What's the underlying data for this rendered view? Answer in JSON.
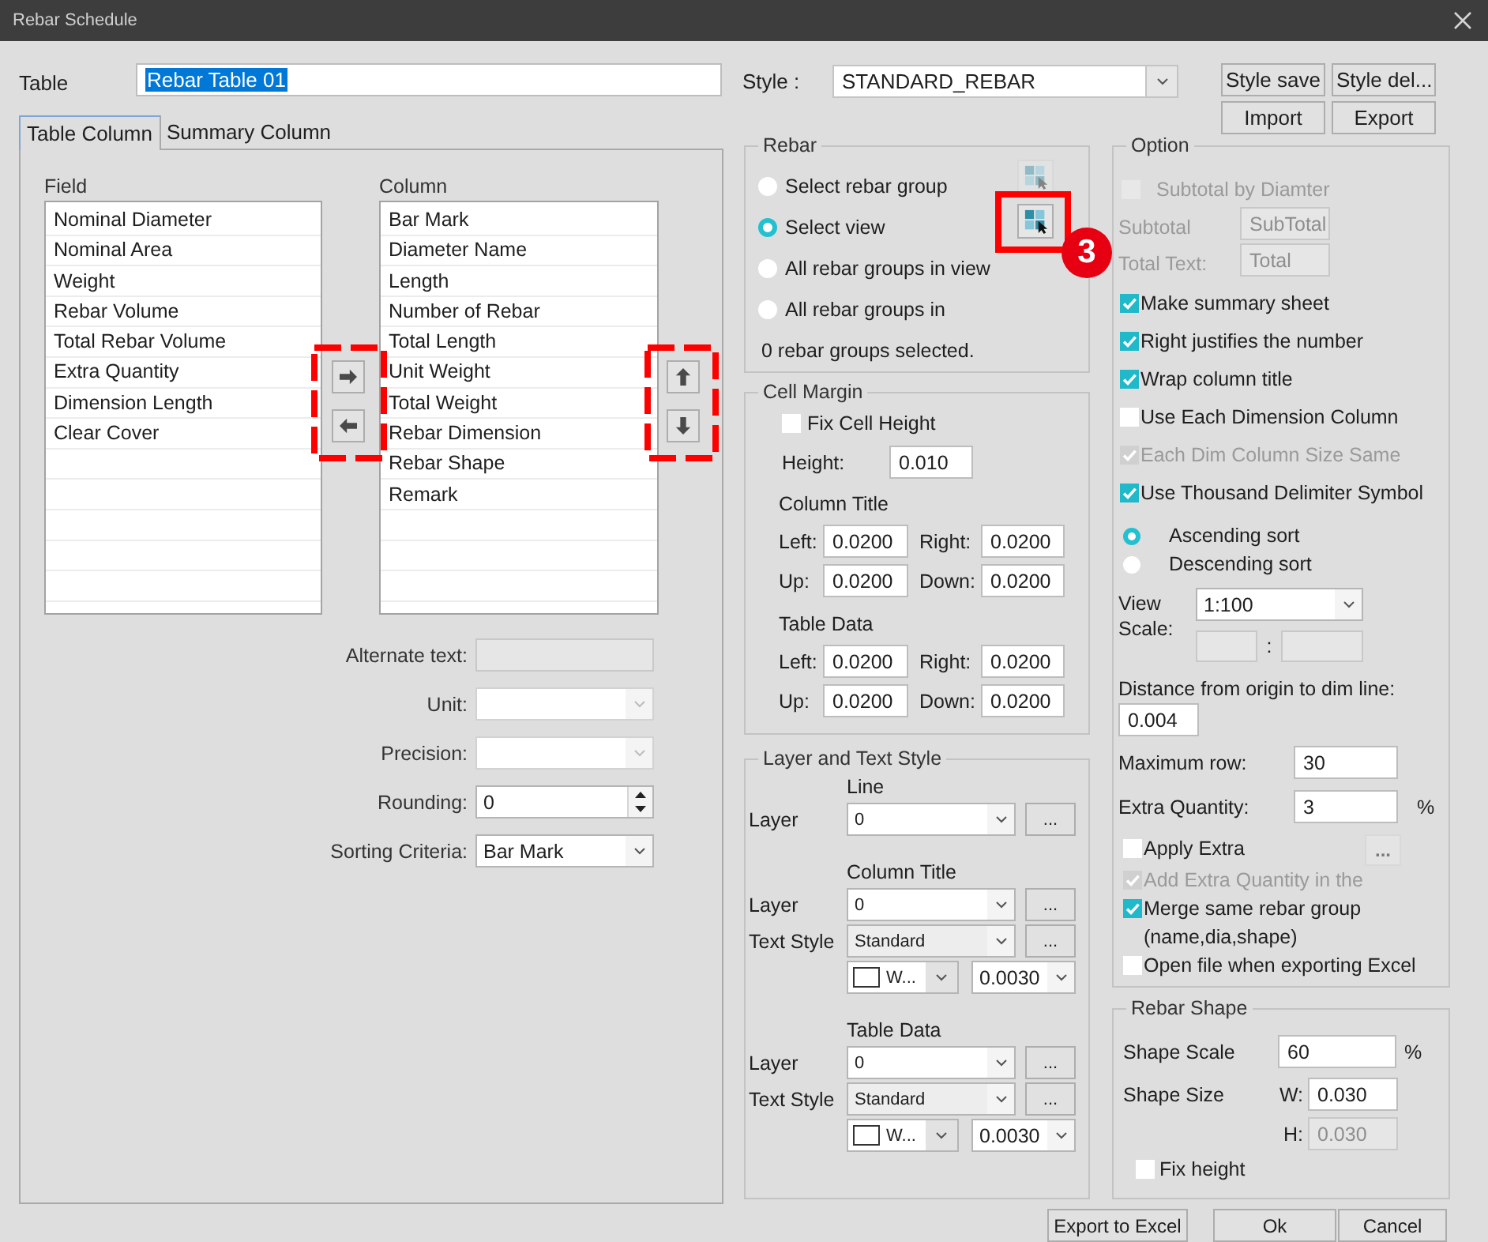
{
  "window": {
    "title": "Rebar Schedule"
  },
  "table": {
    "label": "Table",
    "value": "Rebar Table 01",
    "text_selected": true
  },
  "style": {
    "label": "Style :",
    "value": "STANDARD_REBAR"
  },
  "style_buttons": [
    "Style save",
    "Style del...",
    "Import",
    "Export"
  ],
  "tabs": [
    {
      "label": "Table Column",
      "selected": true
    },
    {
      "label": "Summary Column",
      "selected": false
    }
  ],
  "field_list": {
    "title": "Field",
    "items": [
      "Nominal Diameter",
      "Nominal Area",
      "Weight",
      "Rebar Volume",
      "Total Rebar Volume",
      "Extra Quantity",
      "Dimension Length",
      "Clear Cover"
    ]
  },
  "transfer_buttons": {
    "highlighted": true
  },
  "column_list": {
    "title": "Column",
    "items": [
      "Bar Mark",
      "Diameter Name",
      "Length",
      "Number of Rebar",
      "Total Length",
      "Unit Weight",
      "Total Weight",
      "Rebar Dimension",
      "Rebar Shape",
      "Remark"
    ]
  },
  "order_buttons": {
    "highlighted": true
  },
  "column_settings": [
    {
      "kind": "text",
      "label": "Alternate text:",
      "disabled": true
    },
    {
      "kind": "combo",
      "label": "Unit:",
      "disabled": true
    },
    {
      "kind": "combo",
      "label": "Precision:",
      "disabled": true
    },
    {
      "kind": "spin",
      "label": "Rounding:",
      "value": "0",
      "disabled": false
    },
    {
      "kind": "combo",
      "label": "Sorting Criteria:",
      "value": "Bar Mark",
      "disabled": false
    }
  ],
  "rebar": {
    "title": "Rebar",
    "options": [
      {
        "label": "Select rebar group",
        "selected": false
      },
      {
        "label": "Select view",
        "selected": true
      },
      {
        "label": "All rebar groups in view",
        "selected": false
      },
      {
        "label": "All rebar groups in",
        "selected": false
      }
    ],
    "pick_buttons": [
      {
        "disabled": true,
        "highlighted": false
      },
      {
        "disabled": false,
        "highlighted": true,
        "badge": "3"
      }
    ],
    "status": "0 rebar groups selected."
  },
  "cell_margin": {
    "title": "Cell Margin",
    "fix_cell_height": {
      "label": "Fix Cell Height",
      "checked": false
    },
    "height": {
      "label": "Height:",
      "value": "0.010"
    },
    "sections": [
      {
        "title": "Column Title",
        "fields": [
          {
            "label": "Left:",
            "value": "0.0200"
          },
          {
            "label": "Right:",
            "value": "0.0200"
          },
          {
            "label": "Up:",
            "value": "0.0200"
          },
          {
            "label": "Down:",
            "value": "0.0200"
          }
        ]
      },
      {
        "title": "Table Data",
        "fields": [
          {
            "label": "Left:",
            "value": "0.0200"
          },
          {
            "label": "Right:",
            "value": "0.0200"
          },
          {
            "label": "Up:",
            "value": "0.0200"
          },
          {
            "label": "Down:",
            "value": "0.0200"
          }
        ]
      }
    ]
  },
  "layer_text_style": {
    "title": "Layer and Text Style",
    "sections": [
      {
        "title": "Line",
        "rows": [
          {
            "kind": "layer",
            "label": "Layer",
            "value": "0",
            "more": "..."
          }
        ]
      },
      {
        "title": "Column Title",
        "rows": [
          {
            "kind": "layer",
            "label": "Layer",
            "value": "0",
            "more": "..."
          },
          {
            "kind": "text_style",
            "label": "Text Style",
            "value": "Standard",
            "more": "..."
          },
          {
            "kind": "color_size",
            "color": "#ffffff",
            "color_label": "W...",
            "size": "0.0030"
          }
        ]
      },
      {
        "title": "Table Data",
        "rows": [
          {
            "kind": "layer",
            "label": "Layer",
            "value": "0",
            "more": "..."
          },
          {
            "kind": "text_style",
            "label": "Text Style",
            "value": "Standard",
            "more": "..."
          },
          {
            "kind": "color_size",
            "color": "#ffffff",
            "color_label": "W...",
            "size": "0.0030"
          }
        ]
      }
    ]
  },
  "option": {
    "title": "Option",
    "subtotal_by_diameter": {
      "label": "Subtotal by Diamter",
      "checked": false,
      "disabled": true
    },
    "subtotal_fields": [
      {
        "label": "Subtotal",
        "value": "SubTotal",
        "disabled": true
      },
      {
        "label": "Total Text:",
        "value": "Total",
        "disabled": true
      }
    ],
    "checks": [
      {
        "label": "Make summary sheet",
        "checked": true,
        "disabled": false
      },
      {
        "label": "Right justifies the number",
        "checked": true,
        "disabled": false
      },
      {
        "label": "Wrap column title",
        "checked": true,
        "disabled": false
      },
      {
        "label": "Use Each Dimension Column",
        "checked": false,
        "disabled": false
      },
      {
        "label": "Each Dim Column Size Same",
        "checked": true,
        "disabled": true
      },
      {
        "label": "Use Thousand Delimiter Symbol",
        "checked": true,
        "disabled": false
      }
    ],
    "sort": [
      {
        "label": "Ascending sort",
        "selected": true
      },
      {
        "label": "Descending sort",
        "selected": false
      }
    ],
    "view_scale": {
      "label": "View Scale:",
      "value": "1:100",
      "separator": ":"
    },
    "distance": {
      "label": "Distance from origin to dim line:",
      "value": "0.004"
    },
    "maximum_row": {
      "label": "Maximum row:",
      "value": "30"
    },
    "extra_quantity": {
      "label": "Extra Quantity:",
      "value": "3",
      "unit": "%"
    },
    "extra_checks": [
      {
        "label": "Apply Extra",
        "checked": false,
        "disabled": false,
        "more": "...",
        "more_disabled": true
      },
      {
        "label": "Add Extra Quantity in the",
        "checked": true,
        "disabled": true
      },
      {
        "label": "Merge same rebar group\n(name,dia,shape)",
        "checked": true,
        "disabled": false
      },
      {
        "label": "Open file when exporting Excel",
        "checked": false,
        "disabled": false
      }
    ]
  },
  "rebar_shape": {
    "title": "Rebar Shape",
    "scale": {
      "label": "Shape Scale",
      "value": "60",
      "unit": "%"
    },
    "size": {
      "label": "Shape Size",
      "fields": [
        {
          "label": "W:",
          "value": "0.030",
          "disabled": false
        },
        {
          "label": "H:",
          "value": "0.030",
          "disabled": true
        }
      ]
    },
    "fix_height": {
      "label": "Fix height",
      "checked": false
    }
  },
  "footer_buttons": [
    "Export to Excel",
    "Ok",
    "Cancel"
  ]
}
